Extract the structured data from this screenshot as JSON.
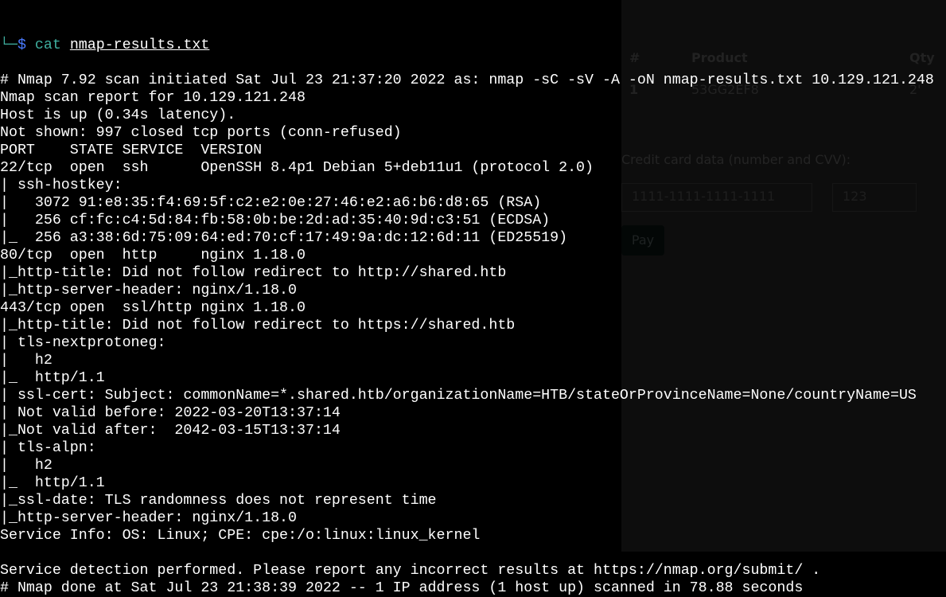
{
  "background_page": {
    "table_headers": [
      "#",
      "Product",
      "Qty"
    ],
    "table_row": [
      "1",
      "53GG2EF8",
      "2'"
    ],
    "card_label": "Credit card data (number and CVV):",
    "card_number_value": "1111-1111-1111-1111",
    "cvv_value": "123",
    "pay_button": "Pay"
  },
  "prompt": {
    "prefix": "└─",
    "symbol": "$",
    "command": "cat",
    "argument": "nmap-results.txt"
  },
  "output_lines": [
    "# Nmap 7.92 scan initiated Sat Jul 23 21:37:20 2022 as: nmap -sC -sV -A -oN nmap-results.txt 10.129.121.248",
    "Nmap scan report for 10.129.121.248",
    "Host is up (0.34s latency).",
    "Not shown: 997 closed tcp ports (conn-refused)",
    "PORT    STATE SERVICE  VERSION",
    "22/tcp  open  ssh      OpenSSH 8.4p1 Debian 5+deb11u1 (protocol 2.0)",
    "| ssh-hostkey: ",
    "|   3072 91:e8:35:f4:69:5f:c2:e2:0e:27:46:e2:a6:b6:d8:65 (RSA)",
    "|   256 cf:fc:c4:5d:84:fb:58:0b:be:2d:ad:35:40:9d:c3:51 (ECDSA)",
    "|_  256 a3:38:6d:75:09:64:ed:70:cf:17:49:9a:dc:12:6d:11 (ED25519)",
    "80/tcp  open  http     nginx 1.18.0",
    "|_http-title: Did not follow redirect to http://shared.htb",
    "|_http-server-header: nginx/1.18.0",
    "443/tcp open  ssl/http nginx 1.18.0",
    "|_http-title: Did not follow redirect to https://shared.htb",
    "| tls-nextprotoneg: ",
    "|   h2",
    "|_  http/1.1",
    "| ssl-cert: Subject: commonName=*.shared.htb/organizationName=HTB/stateOrProvinceName=None/countryName=US",
    "| Not valid before: 2022-03-20T13:37:14",
    "|_Not valid after:  2042-03-15T13:37:14",
    "| tls-alpn: ",
    "|   h2",
    "|_  http/1.1",
    "|_ssl-date: TLS randomness does not represent time",
    "|_http-server-header: nginx/1.18.0",
    "Service Info: OS: Linux; CPE: cpe:/o:linux:linux_kernel",
    "",
    "Service detection performed. Please report any incorrect results at https://nmap.org/submit/ .",
    "# Nmap done at Sat Jul 23 21:38:39 2022 -- 1 IP address (1 host up) scanned in 78.88 seconds"
  ]
}
